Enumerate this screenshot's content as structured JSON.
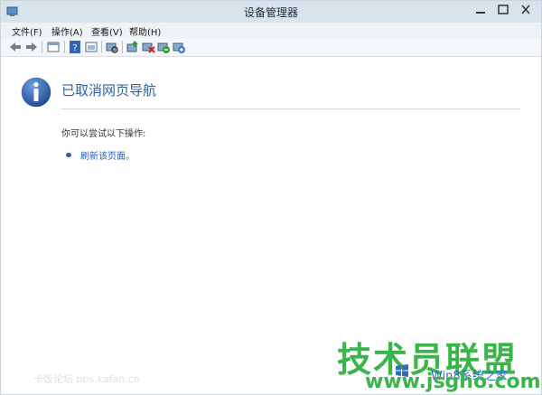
{
  "window": {
    "title": "设备管理器"
  },
  "menu": {
    "items": [
      {
        "label": "文件(F)"
      },
      {
        "label": "操作(A)"
      },
      {
        "label": "查看(V)"
      },
      {
        "label": "帮助(H)"
      }
    ]
  },
  "toolbar": {
    "icons": [
      "back-arrow-icon",
      "forward-arrow-icon",
      "properties-icon",
      "help-icon",
      "view-icon",
      "scan-hardware-icon",
      "update-driver-icon",
      "uninstall-icon",
      "disable-icon",
      "enable-icon"
    ]
  },
  "page": {
    "heading": "已取消网页导航",
    "hint": "你可以尝试以下操作:",
    "link": "刷新该页面。"
  },
  "watermarks": {
    "left": "卡饭论坛 bbs.kafan.cn",
    "logo": "技术员联盟",
    "win8": "Win8系统之家",
    "url": "www.jsgho.com"
  },
  "colors": {
    "heading": "#2a62a8",
    "link": "#2160b8",
    "watermark_green": "#39b54a"
  }
}
